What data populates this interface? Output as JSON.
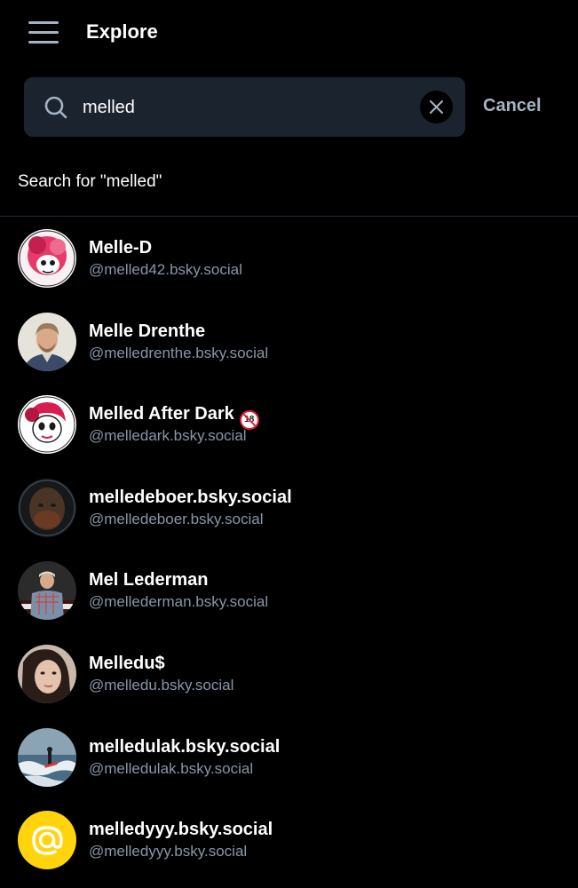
{
  "header": {
    "title": "Explore",
    "menu_icon": "hamburger-menu-icon"
  },
  "search": {
    "value": "melled",
    "placeholder": "",
    "icon": "search-icon",
    "clear_icon": "close-icon",
    "cancel_label": "Cancel",
    "search_for_label": "Search for \"melled\""
  },
  "colors": {
    "background": "#000000",
    "search_field": "#1b232f",
    "muted_text": "#8896a8",
    "accent_gray": "#a6b3c4",
    "default_avatar": "#ffd40d"
  },
  "results": [
    {
      "name": "Melle-D",
      "handle": "@melled42.bsky.social",
      "avatar": "cartoon-pink-character-avatar"
    },
    {
      "name": "Melle Drenthe",
      "handle": "@melledrenthe.bsky.social",
      "avatar": "illustrated-man-portrait-avatar"
    },
    {
      "name": "Melled After Dark",
      "handle": "@melledark.bsky.social",
      "avatar": "cartoon-character-avatar",
      "badge": "18",
      "badge_icon": "adult-content-18-icon"
    },
    {
      "name": "melledeboer.bsky.social",
      "handle": "@melledeboer.bsky.social",
      "avatar": "dark-face-photo-avatar"
    },
    {
      "name": "Mel Lederman",
      "handle": "@mellederman.bsky.social",
      "avatar": "man-playing-keyboard-photo-avatar"
    },
    {
      "name": "Melledu$",
      "handle": "@melledu.bsky.social",
      "avatar": "woman-selfie-photo-avatar"
    },
    {
      "name": "melledulak.bsky.social",
      "handle": "@melledulak.bsky.social",
      "avatar": "surfer-ocean-photo-avatar"
    },
    {
      "name": "melledyyy.bsky.social",
      "handle": "@melledyyy.bsky.social",
      "avatar": "default-at-sign-avatar",
      "avatar_glyph": "@"
    }
  ]
}
